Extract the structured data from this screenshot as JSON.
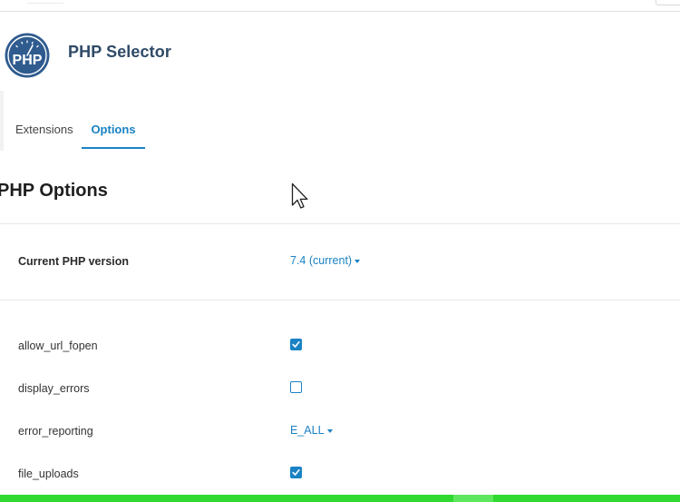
{
  "header": {
    "logo_text": "PHP",
    "title": "PHP Selector"
  },
  "tabs": [
    {
      "label": "Extensions",
      "active": false
    },
    {
      "label": "Options",
      "active": true
    }
  ],
  "section": {
    "title": "PHP Options"
  },
  "version": {
    "label": "Current PHP version",
    "value": "7.4 (current)"
  },
  "options": [
    {
      "name": "allow_url_fopen",
      "type": "checkbox",
      "checked": true
    },
    {
      "name": "display_errors",
      "type": "checkbox",
      "checked": false
    },
    {
      "name": "error_reporting",
      "type": "select",
      "value": "E_ALL"
    },
    {
      "name": "file_uploads",
      "type": "checkbox",
      "checked": true
    }
  ],
  "colors": {
    "accent": "#1a82c4",
    "title": "#2f4a67",
    "logo_bg": "#2f5b8f",
    "status_bar": "#2fd92f"
  },
  "icons": {
    "logo": "php-logo-icon",
    "checked": "check-icon",
    "dropdown": "caret-down-icon",
    "pointer": "mouse-cursor-icon"
  }
}
